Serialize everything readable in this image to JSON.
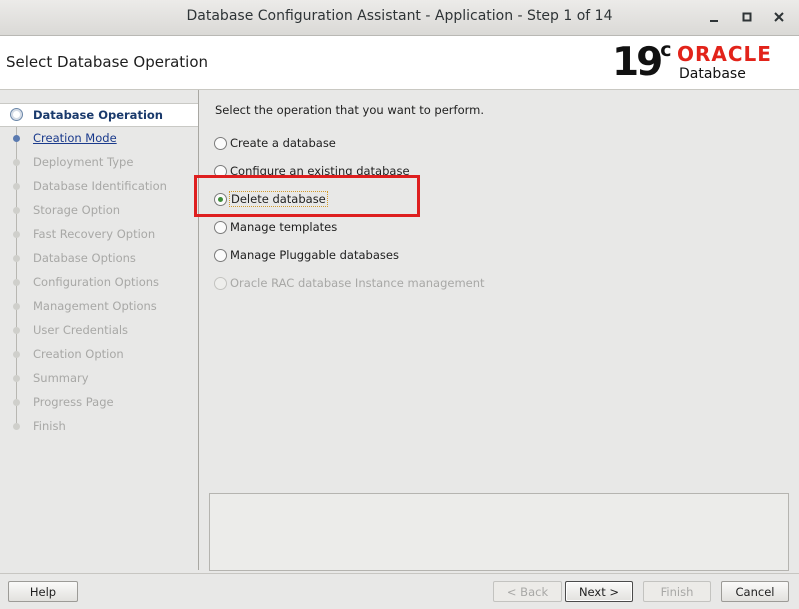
{
  "window": {
    "title": "Database Configuration Assistant - Application - Step 1 of 14",
    "minimize_icon": "minimize-icon",
    "maximize_icon": "maximize-icon",
    "close_icon": "close-icon"
  },
  "header": {
    "page_title": "Select Database Operation",
    "logo_version": "19",
    "logo_version_sup": "c",
    "logo_brand": "ORACLE",
    "logo_product": "Database",
    "brand_color": "#e2231a"
  },
  "nav": {
    "items": [
      {
        "label": "Database Operation",
        "state": "active"
      },
      {
        "label": "Creation Mode",
        "state": "link"
      },
      {
        "label": "Deployment Type",
        "state": "disabled"
      },
      {
        "label": "Database Identification",
        "state": "disabled"
      },
      {
        "label": "Storage Option",
        "state": "disabled"
      },
      {
        "label": "Fast Recovery Option",
        "state": "disabled"
      },
      {
        "label": "Database Options",
        "state": "disabled"
      },
      {
        "label": "Configuration Options",
        "state": "disabled"
      },
      {
        "label": "Management Options",
        "state": "disabled"
      },
      {
        "label": "User Credentials",
        "state": "disabled"
      },
      {
        "label": "Creation Option",
        "state": "disabled"
      },
      {
        "label": "Summary",
        "state": "disabled"
      },
      {
        "label": "Progress Page",
        "state": "disabled"
      },
      {
        "label": "Finish",
        "state": "disabled"
      }
    ]
  },
  "main": {
    "instruction": "Select the operation that you want to perform.",
    "options": [
      {
        "label": "Create a database",
        "selected": false,
        "enabled": true
      },
      {
        "label": "Configure an existing database",
        "selected": false,
        "enabled": true
      },
      {
        "label": "Delete database",
        "selected": true,
        "enabled": true
      },
      {
        "label": "Manage templates",
        "selected": false,
        "enabled": true
      },
      {
        "label": "Manage Pluggable databases",
        "selected": false,
        "enabled": true
      },
      {
        "label": "Oracle RAC database Instance management",
        "selected": false,
        "enabled": false
      }
    ],
    "highlight_color": "#de1f1f"
  },
  "footer": {
    "help": "Help",
    "back": "< Back",
    "next": "Next >",
    "finish": "Finish",
    "cancel": "Cancel"
  }
}
